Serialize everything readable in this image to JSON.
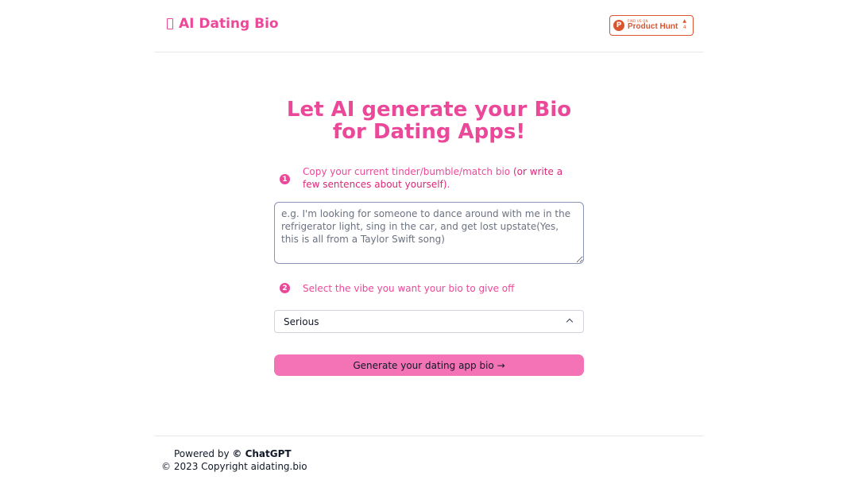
{
  "header": {
    "brand_label": "AI Dating Bio",
    "product_hunt": {
      "small_text": "FIND US ON",
      "name": "Product Hunt",
      "logo_letter": "P",
      "vote_arrow": "▲",
      "vote_count": "4"
    }
  },
  "main": {
    "title": "Let AI generate your Bio for Dating Apps!",
    "step1": {
      "number": "1",
      "text": "Copy your current tinder/bumble/match bio",
      "hint": "(or write a few sentences about yourself)",
      "suffix": "."
    },
    "bio_input": {
      "placeholder": "e.g. I'm looking for someone to dance around with me in the refrigerator light, sing in the car, and get lost upstate(Yes, this is all from a Taylor Swift song)",
      "value": ""
    },
    "step2": {
      "number": "2",
      "text": "Select the vibe you want your bio to give off"
    },
    "vibe_select": {
      "selected": "Serious"
    },
    "generate_button": "Generate your dating app bio →"
  },
  "footer": {
    "powered_prefix": "Powered by",
    "powered_brand": "© ChatGPT",
    "copyright": "© 2023 Copyright aidating.bio"
  },
  "colors": {
    "accent": "#ec4899",
    "button": "#f472b6",
    "product_hunt": "#da552f"
  }
}
